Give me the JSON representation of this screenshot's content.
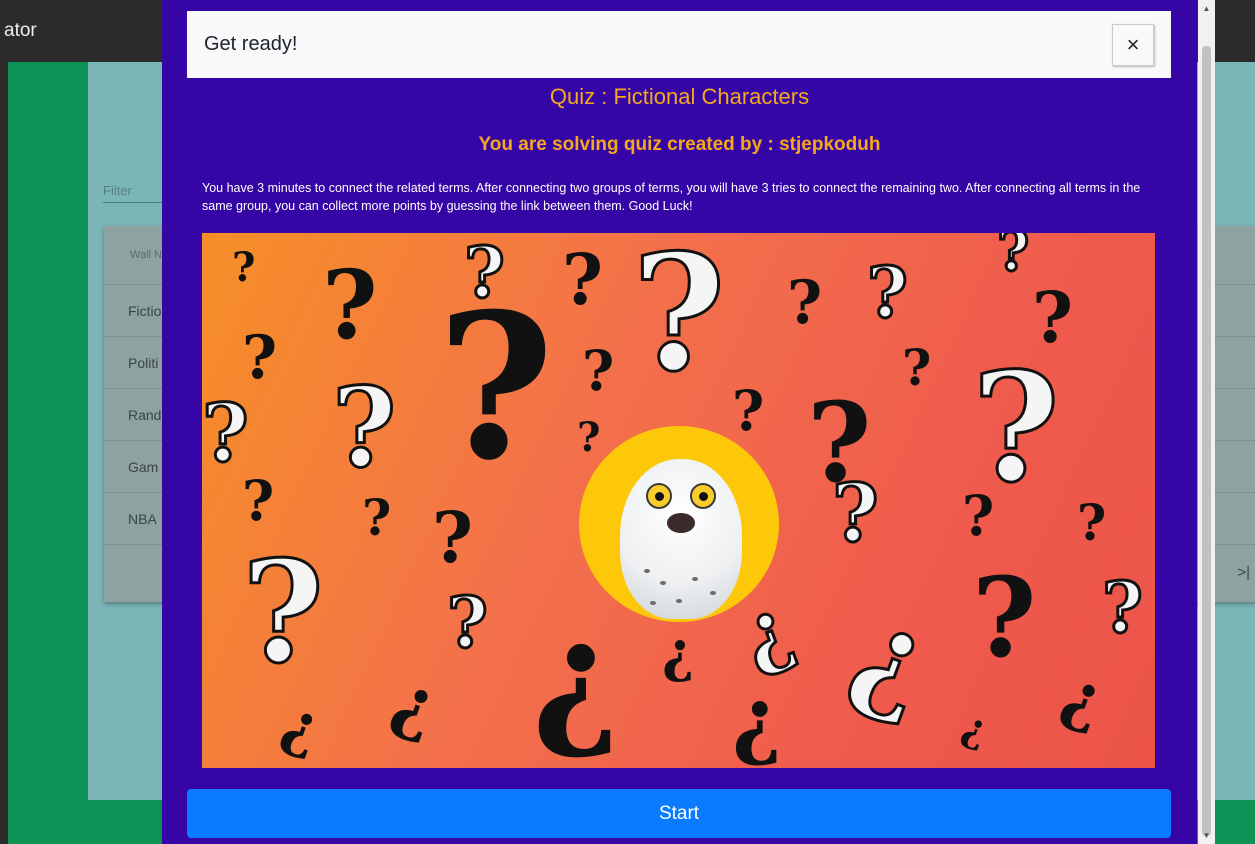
{
  "background": {
    "brand": "ator",
    "filter_label": "Filter",
    "table_header": "Wall N",
    "rows": [
      "Fictio",
      "Politi",
      "Rand",
      "Gam",
      "NBA"
    ],
    "pager_last": ">|"
  },
  "modal": {
    "title": "Get ready!",
    "close_symbol": "×",
    "quiz_title": "Quiz : Fictional Characters",
    "creator_line": "You are solving quiz created by : stjepkoduh",
    "instructions": "You have 3 minutes to connect the related terms. After connecting two groups of terms, you will have 3 tries to connect the remaining two. After connecting all terms in the same group, you can collect more points by guessing the link between them. Good Luck!",
    "start_label": "Start"
  },
  "colors": {
    "modal_bg": "#3506a5",
    "accent_orange": "#f5a81d",
    "start_blue": "#0a7bff",
    "app_green": "#0c9255"
  },
  "icons": {
    "close": "close-icon",
    "scroll_up": "scroll-up-arrow-icon",
    "scroll_down": "scroll-down-arrow-icon"
  }
}
